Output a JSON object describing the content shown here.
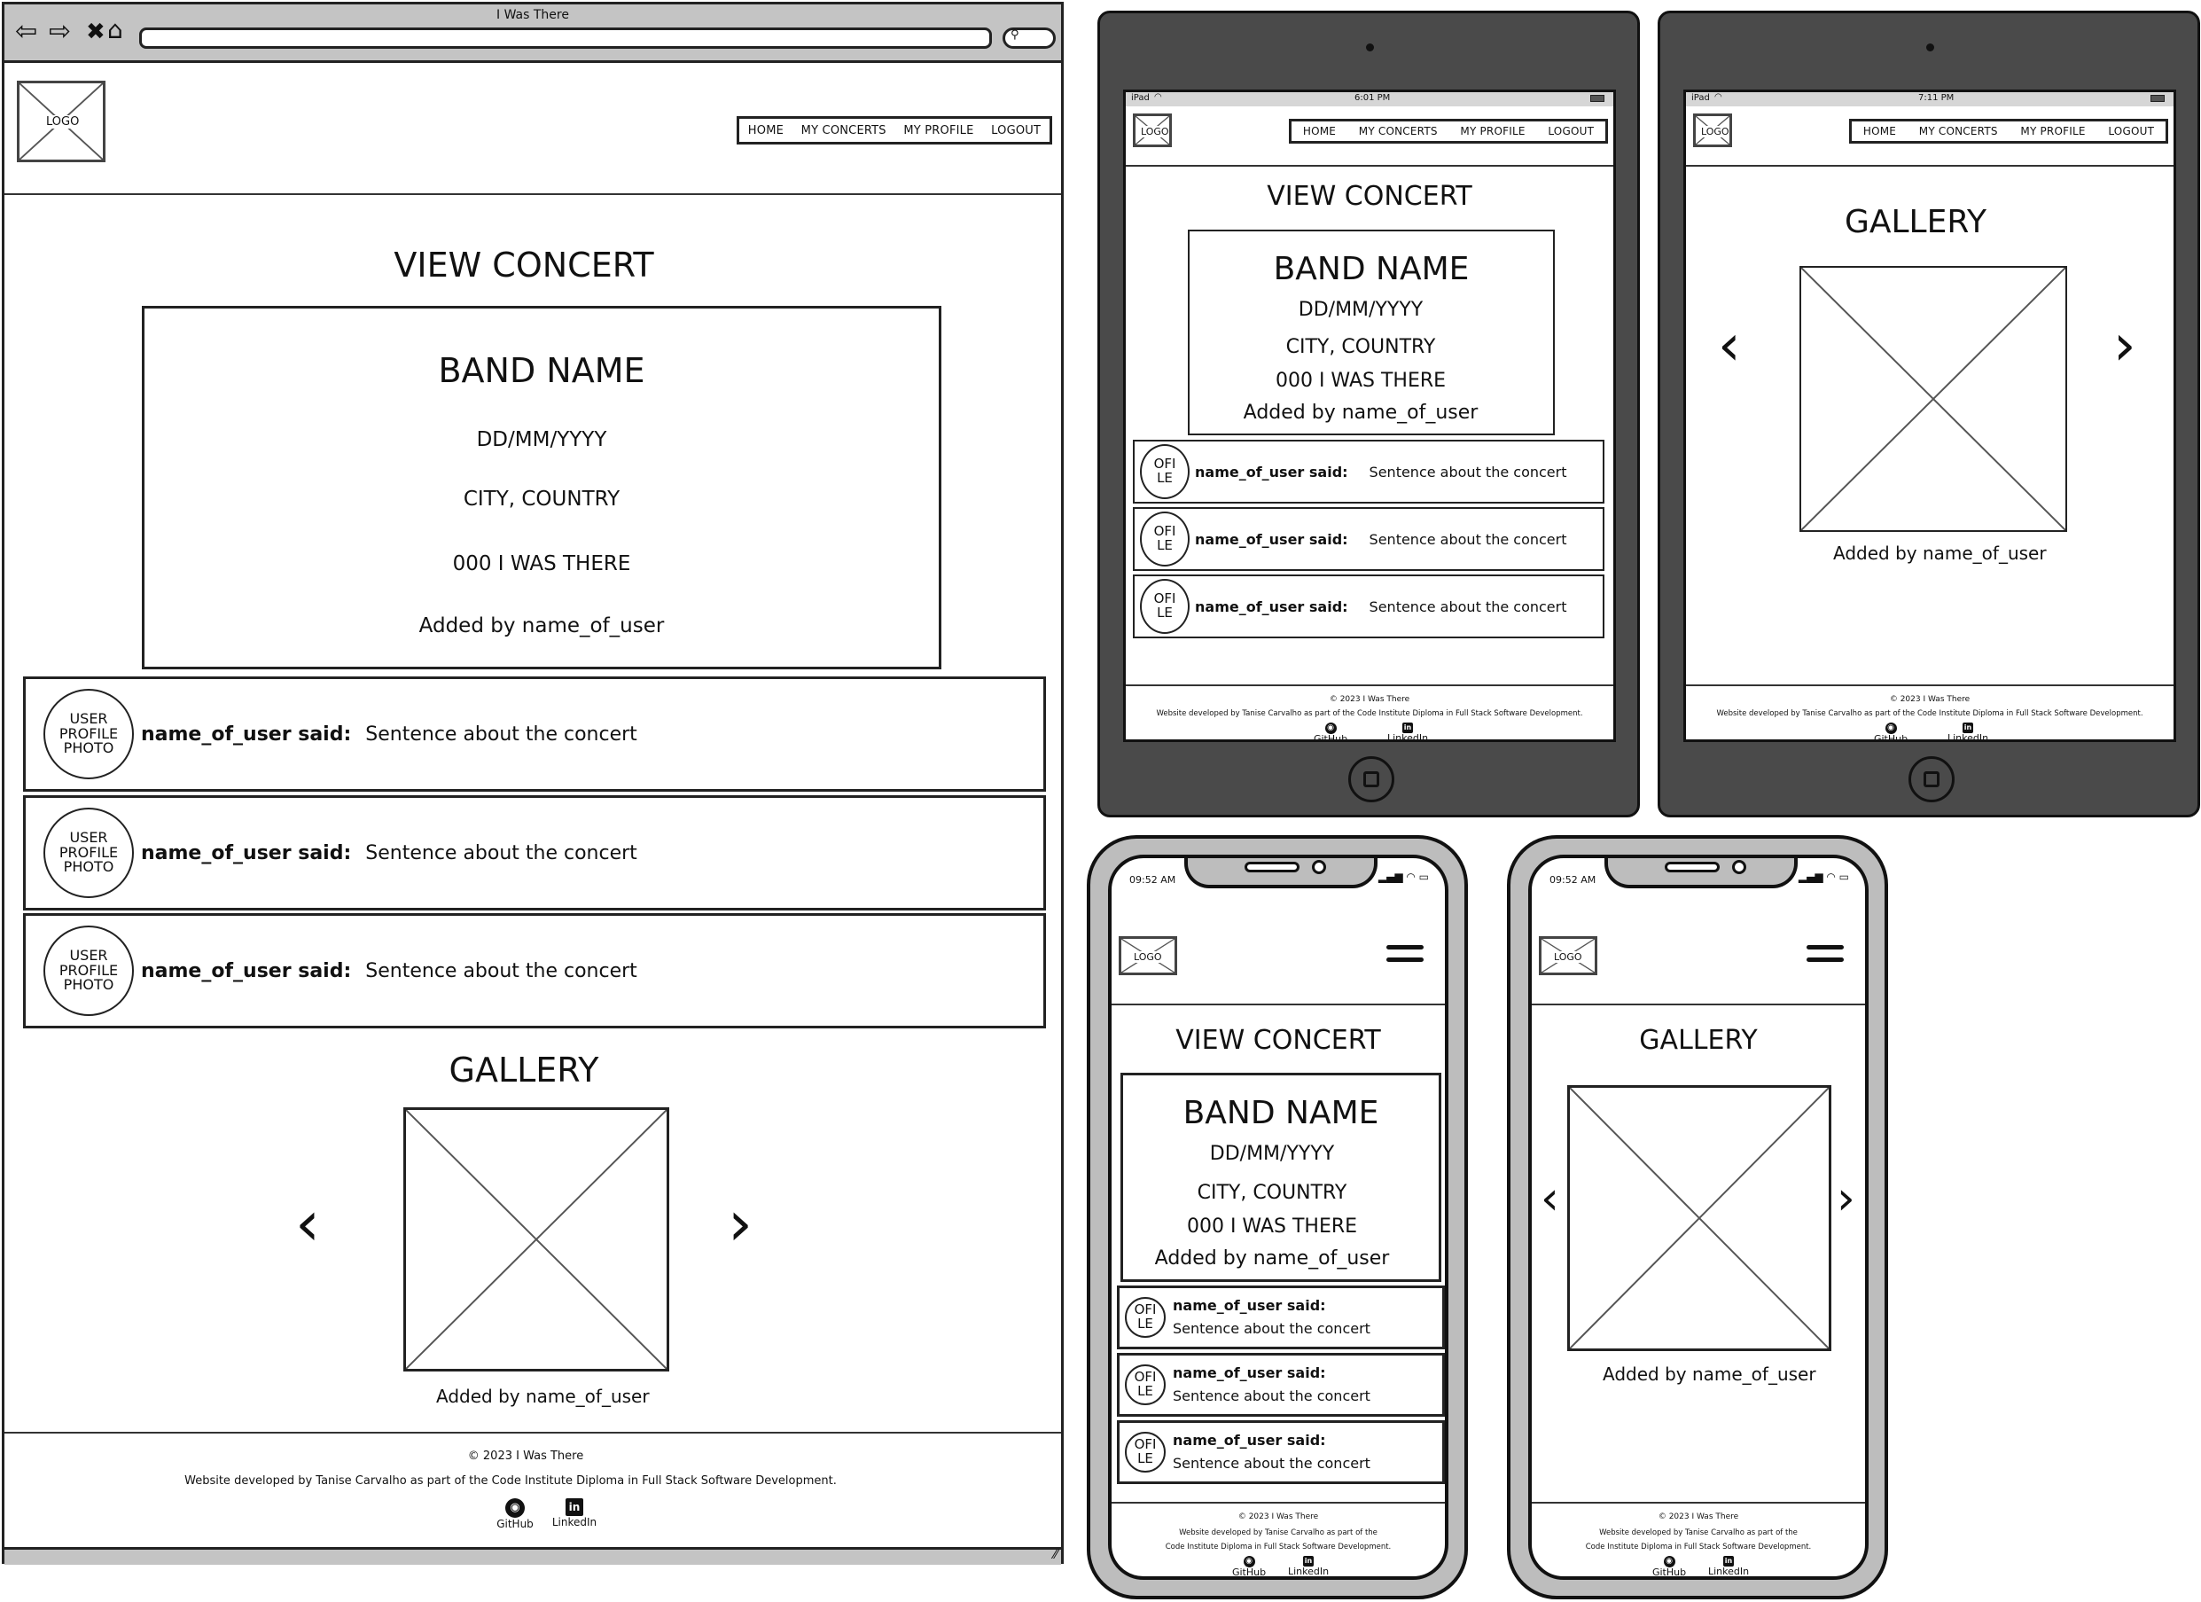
{
  "browser": {
    "window_title": "I Was There"
  },
  "nav": {
    "home": "HOME",
    "concerts": "MY CONCERTS",
    "profile": "MY PROFILE",
    "logout": "LOGOUT"
  },
  "logo": "LOGO",
  "view_title": "VIEW CONCERT",
  "concert": {
    "band": "BAND NAME",
    "date": "DD/MM/YYYY",
    "location": "CITY, COUNTRY",
    "count": "000 I WAS THERE",
    "added_by": "Added by name_of_user"
  },
  "comment": {
    "avatar_text": "USER PROFILE PHOTO",
    "avatar_short": "OFI LE",
    "user": "name_of_user said:",
    "text": "Sentence about the concert"
  },
  "gallery": {
    "title": "GALLERY",
    "added_by": "Added by name_of_user"
  },
  "footer": {
    "copyright": "© 2023 I Was There",
    "credit": "Website developed by Tanise Carvalho as part of the Code Institute Diploma in Full Stack Software Development.",
    "credit_line1": "Website developed by Tanise Carvalho as part of the",
    "credit_line2": "Code Institute Diploma in Full Stack Software Development.",
    "github": "GitHub",
    "linkedin": "LinkedIn"
  },
  "tablet1": {
    "device": "iPad",
    "time": "6:01 PM"
  },
  "tablet2": {
    "device": "iPad",
    "time": "7:11 PM"
  },
  "phone": {
    "time": "09:52 AM"
  },
  "colors": {
    "device_dark": "#4a4a4a",
    "phone_frame": "#bdbdbd",
    "chrome": "#bfbfbf"
  }
}
